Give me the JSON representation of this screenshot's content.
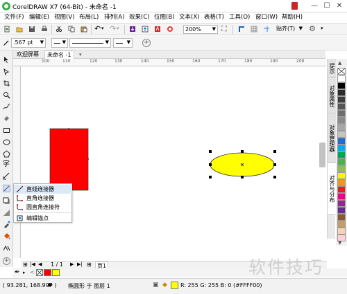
{
  "window": {
    "title": "CorelDRAW X7 (64-Bit) - 未命名 -1"
  },
  "menu": [
    "文件(F)",
    "编辑(E)",
    "视图(V)",
    "布局(L)",
    "排列(A)",
    "效果(C)",
    "位图(B)",
    "文本(X)",
    "表格(T)",
    "工具(O)",
    "窗口(W)",
    "帮助(H)"
  ],
  "toolbar": {
    "zoom": "200%",
    "snap_label": "贴齐(T)"
  },
  "property_bar": {
    "outline_width": ".567 pt"
  },
  "doc_tabs": [
    "欢迎屏幕",
    "未命名 -1"
  ],
  "ruler": {
    "top_ticks": [
      "100",
      "110",
      "120",
      "130",
      "140",
      "150",
      "160",
      "170",
      "180",
      "190",
      "200"
    ]
  },
  "docker_tabs": [
    "提示",
    "对象属性",
    "对象管理器",
    "对齐与分布"
  ],
  "flyout": {
    "items": [
      "直线连接器",
      "直角连接器",
      "圆直角连接符",
      "编辑锚点"
    ]
  },
  "page_nav": {
    "counter": "1 / 1",
    "page_tab": "页1"
  },
  "status": {
    "coords": "( 93.281, 168.997 )",
    "object_info": "椭圆形 于 图层 1",
    "fill_info": "R: 255 G: 255 B: 0 (#FFFF00)"
  },
  "colors": {
    "rect_fill": "#FF0000",
    "ellipse_fill": "#FFFF00",
    "palette": [
      "#FFFFFF",
      "#000000",
      "#2b2b2b",
      "#3d3d3d",
      "#555555",
      "#6e6e6e",
      "#8a8a8a",
      "#a8a8a8",
      "#c4c4c4",
      "#1c6fd1",
      "#00aeef",
      "#00a651",
      "#4caf50",
      "#8bc34a",
      "#fff200",
      "#f7941d",
      "#ed1c24",
      "#ec008c",
      "#92278f",
      "#662d91",
      "#8b5a2b",
      "#c69c6d",
      "#f5d5b5",
      "#ffd1dc"
    ]
  },
  "watermark": "软件技巧"
}
